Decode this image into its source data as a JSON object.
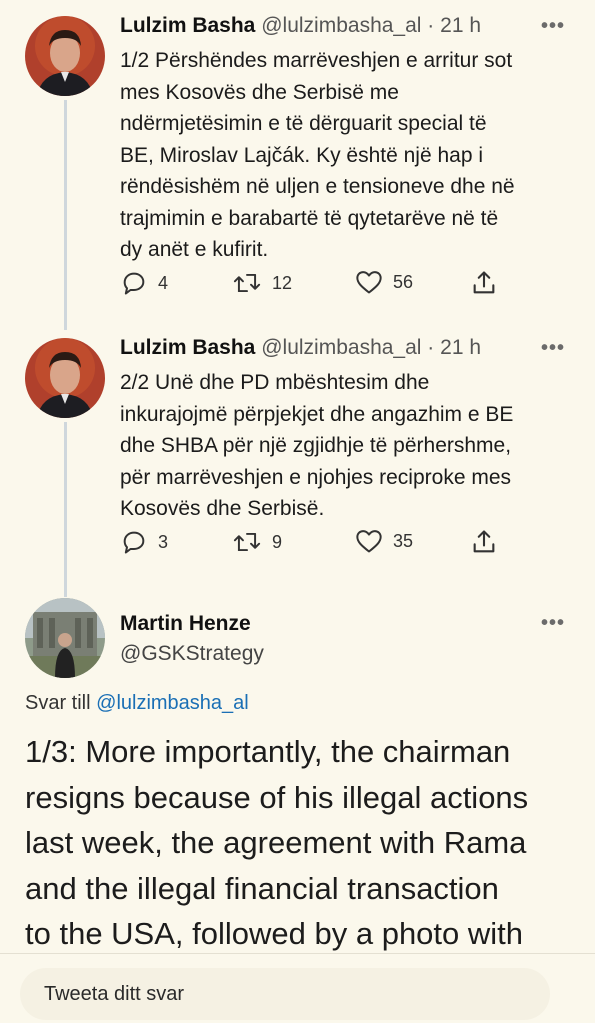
{
  "tweets": [
    {
      "name": "Lulzim Basha",
      "handle": "@lulzimbasha_al",
      "time": "21 h",
      "lines": [
        "1/2 Përshëndes marrëveshjen e arritur sot",
        "mes Kosovës dhe Serbisë me",
        "ndërmjetësimin e të dërguarit special të",
        "BE, Miroslav Lajčák. Ky është një hap i",
        "rëndësishëm në uljen e tensioneve dhe në",
        "trajmimin e barabartë të qytetarëve në të",
        "dy anët e kufirit."
      ],
      "replies": "4",
      "retweets": "12",
      "likes": "56"
    },
    {
      "name": "Lulzim Basha",
      "handle": "@lulzimbasha_al",
      "time": "21 h",
      "lines": [
        "2/2 Unë dhe PD mbështesim dhe",
        "inkurajojmë përpjekjet dhe angazhim e BE",
        "dhe SHBA për një zgjidhje të përhershme,",
        "për marrëveshjen e njohjes reciproke mes",
        "Kosovës dhe Serbisë."
      ],
      "replies": "3",
      "retweets": "9",
      "likes": "35"
    }
  ],
  "reply_tweet": {
    "name": "Martin Henze",
    "handle": "@GSKStrategy",
    "reply_prefix": "Svar till",
    "reply_mention": "@lulzimbasha_al",
    "lines": [
      "1/3: More importantly, the chairman",
      "resigns because of his illegal actions",
      "last week, the agreement with Rama",
      "and the illegal financial transaction",
      "to the USA, followed by a photo with"
    ]
  },
  "more_icon": "more-horizontal-icon",
  "reply_bar": {
    "placeholder": "Tweeta ditt svar"
  },
  "colors": {
    "background": "#fbf8ec",
    "link": "#1a6fb5",
    "thread_line": "#cfd7dc"
  }
}
